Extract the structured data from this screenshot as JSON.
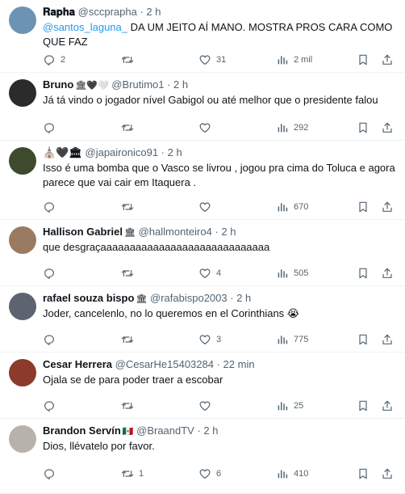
{
  "replies": [
    {
      "name": "𝐑𝐚𝐩𝐡𝐚",
      "emoji": "",
      "handle": "@sccprapha",
      "time": "2 h",
      "mention": "@santos_laguna_",
      "text": " DA UM JEITO AÍ MANO. MOSTRA PROS CARA COMO QUE FAZ",
      "replies": "2",
      "reposts": "",
      "likes": "31",
      "views": "2 mil",
      "avatar_color": "#6d93b3"
    },
    {
      "name": "Bruno",
      "emoji": "🏛🖤🤍",
      "handle": "@Brutimo1",
      "time": "2 h",
      "mention": "",
      "text": "Já tá vindo o jogador nível Gabigol ou até melhor que o presidente falou",
      "replies": "",
      "reposts": "",
      "likes": "",
      "views": "292",
      "avatar_color": "#2b2b2b"
    },
    {
      "name": "⛪🖤🏛",
      "emoji": "",
      "handle": "@japaironico91",
      "time": "2 h",
      "mention": "",
      "text": "Isso é uma bomba que o Vasco se livrou , jogou pra cima do Toluca e agora parece que vai cair em Itaquera .",
      "replies": "",
      "reposts": "",
      "likes": "",
      "views": "670",
      "avatar_color": "#3e4a2e"
    },
    {
      "name": "Hallison Gabriel",
      "emoji": "🏛",
      "handle": "@hallmonteiro4",
      "time": "2 h",
      "mention": "",
      "text": "que desgraçaaaaaaaaaaaaaaaaaaaaaaaaaaaaa",
      "replies": "",
      "reposts": "",
      "likes": "4",
      "views": "505",
      "avatar_color": "#9a7b62"
    },
    {
      "name": "rafael souza bispo",
      "emoji": "🏛",
      "handle": "@rafabispo2003",
      "time": "2 h",
      "mention": "",
      "text": "Joder, cancelenlo, no lo queremos en el Corinthians 😭",
      "replies": "",
      "reposts": "",
      "likes": "3",
      "views": "775",
      "avatar_color": "#5c6470"
    },
    {
      "name": "Cesar Herrera",
      "emoji": "",
      "handle": "@CesarHe15403284",
      "time": "22 min",
      "mention": "",
      "text": "Ojala se de para poder traer a escobar",
      "replies": "",
      "reposts": "",
      "likes": "",
      "views": "25",
      "avatar_color": "#8b3a2c"
    },
    {
      "name": "Brandon Servín",
      "emoji": "🇲🇽",
      "handle": "@BraandTV",
      "time": "2 h",
      "mention": "",
      "text": "Dios, llévatelo por favor.",
      "replies": "",
      "reposts": "1",
      "likes": "6",
      "views": "410",
      "avatar_color": "#b8b2ad"
    }
  ]
}
